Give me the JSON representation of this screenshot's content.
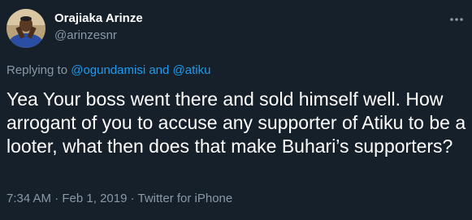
{
  "author": {
    "display_name": "Orajiaka Arinze",
    "handle": "@arinzesnr",
    "avatar": "profile-photo"
  },
  "more_icon": "more-horizontal-icon",
  "reply": {
    "prefix": "Replying to ",
    "mention1": "@ogundamisi",
    "conjunction": " and ",
    "mention2": "@atiku"
  },
  "tweet_text": "Yea Your boss went there and sold himself well. How arrogant of you to accuse any supporter of Atiku to be a looter, what then does that make Buhari’s supporters?",
  "meta": {
    "time": "7:34 AM",
    "sep1": " · ",
    "date": "Feb 1, 2019",
    "sep2": " · ",
    "source": "Twitter for iPhone"
  },
  "colors": {
    "background": "#15202b",
    "text": "#ffffff",
    "secondary": "#8b98a5",
    "link": "#1d9bf0"
  }
}
